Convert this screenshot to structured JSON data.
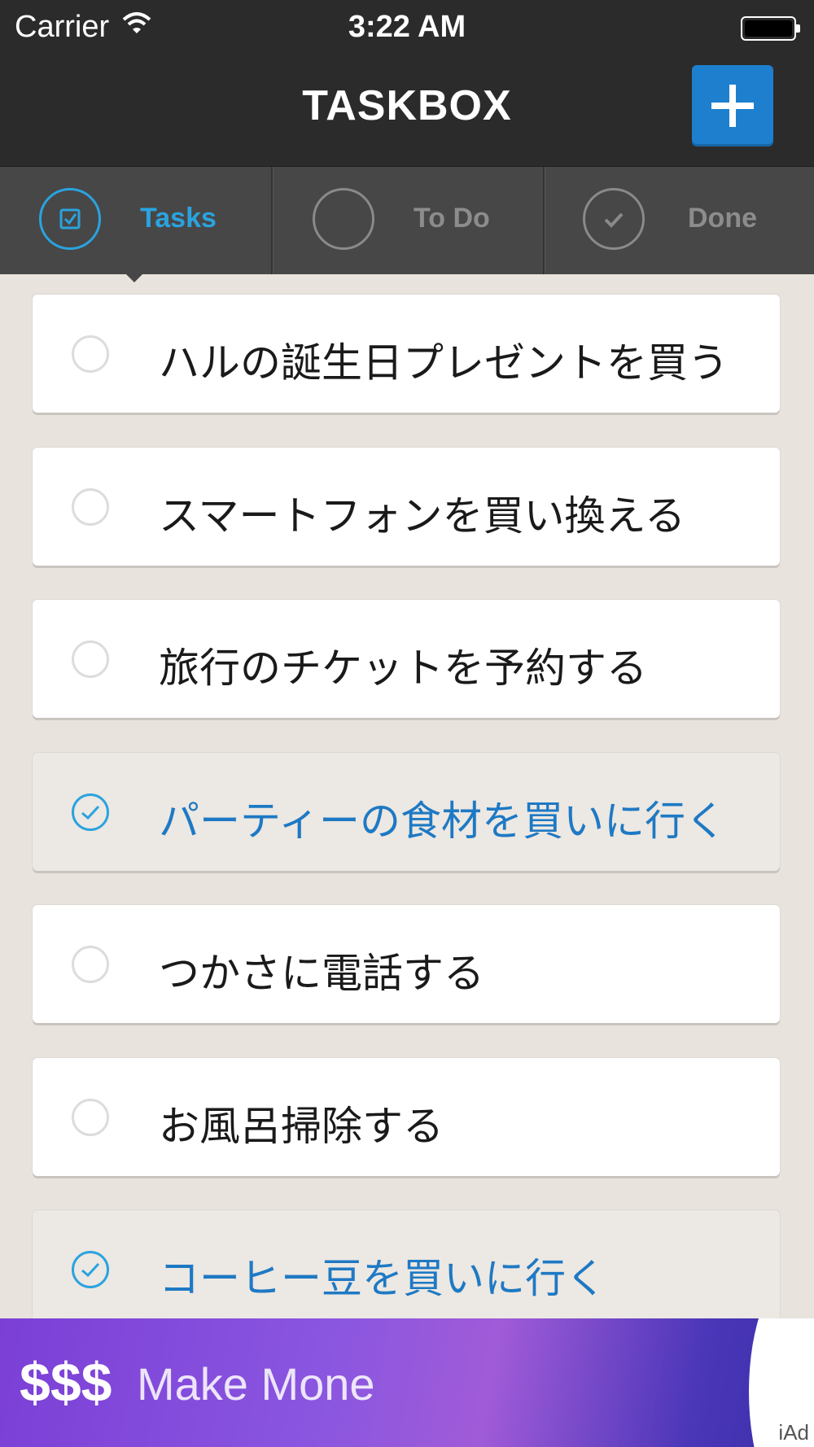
{
  "status_bar": {
    "carrier": "Carrier",
    "time": "3:22 AM"
  },
  "header": {
    "title": "TASKBOX",
    "add_icon": "plus-icon"
  },
  "tabs": [
    {
      "label": "Tasks",
      "icon": "checkbox-icon",
      "active": true
    },
    {
      "label": "To Do",
      "icon": "empty-circle-icon",
      "active": false
    },
    {
      "label": "Done",
      "icon": "checkmark-icon",
      "active": false
    }
  ],
  "tasks": [
    {
      "text": "ハルの誕生日プレゼントを買う",
      "done": false
    },
    {
      "text": "スマートフォンを買い換える",
      "done": false
    },
    {
      "text": "旅行のチケットを予約する",
      "done": false
    },
    {
      "text": "パーティーの食材を買いに行く",
      "done": true
    },
    {
      "text": "つかさに電話する",
      "done": false
    },
    {
      "text": "お風呂掃除する",
      "done": false
    },
    {
      "text": "コーヒー豆を買いに行く",
      "done": true
    }
  ],
  "ad": {
    "symbol": "$$$",
    "text": "Make Mone",
    "label": "iAd"
  },
  "colors": {
    "accent": "#2aa3df",
    "add_button": "#1e7fcf",
    "header_bg": "#2b2b2b",
    "tabs_bg": "#474747",
    "list_bg": "#e8e3dd",
    "done_text": "#1e79c4"
  }
}
